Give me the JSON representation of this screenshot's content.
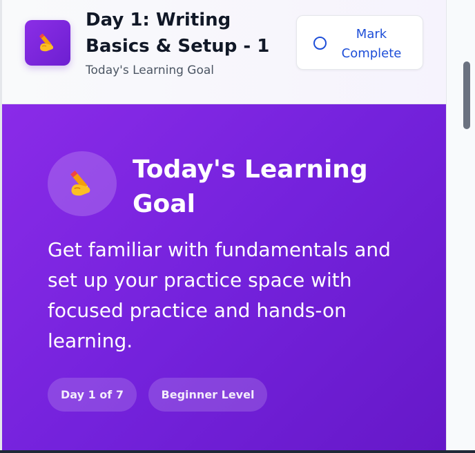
{
  "header": {
    "title": "Day 1: Writing Basics & Setup - 1",
    "subtitle": "Today's Learning Goal",
    "icon": "writing-hand-icon",
    "mark_complete_label": "Mark Complete"
  },
  "hero": {
    "icon": "writing-hand-icon",
    "title": "Today's Learning Goal",
    "description": "Get familiar with fundamentals and set up your practice space with focused practice and hands-on learning.",
    "pills": {
      "day": "Day 1 of 7",
      "level": "Beginner Level"
    }
  },
  "colors": {
    "accent_purple": "#7c3aed",
    "button_text_blue": "#1d4ed8"
  }
}
